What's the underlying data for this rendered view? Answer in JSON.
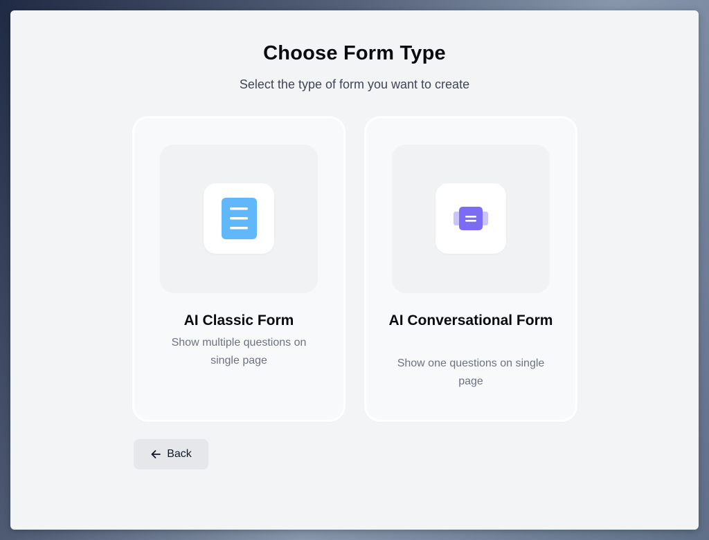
{
  "header": {
    "title": "Choose Form Type",
    "subtitle": "Select the type of form you want to create"
  },
  "cards": [
    {
      "title": "AI Classic Form",
      "description": "Show multiple questions on single page",
      "icon": "document-icon",
      "icon_color": "#60b8fb"
    },
    {
      "title": "AI Conversational Form",
      "description": "Show one questions on single page",
      "icon": "chat-cards-icon",
      "icon_color": "#7c6cf5"
    }
  ],
  "footer": {
    "back_label": "Back",
    "back_icon": "arrow-left-icon"
  },
  "colors": {
    "background": "#f3f4f6",
    "card": "#f8f9fb",
    "button": "#e5e7eb"
  }
}
